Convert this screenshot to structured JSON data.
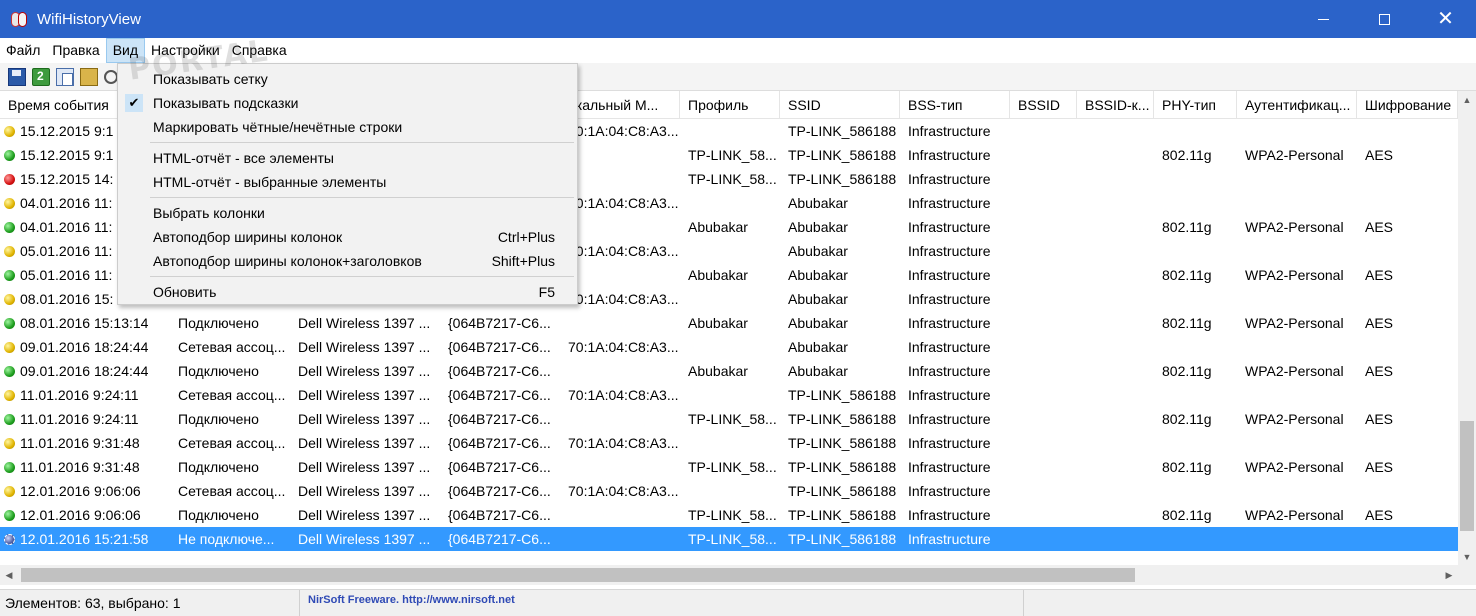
{
  "window": {
    "title": "WifiHistoryView",
    "controls": {
      "minimize": "minimize",
      "maximize": "maximize",
      "close": "✕"
    }
  },
  "menubar": [
    "Файл",
    "Правка",
    "Вид",
    "Настройки",
    "Справка"
  ],
  "toolbar": [
    "save-icon",
    "refresh-icon",
    "copy-icon",
    "properties-icon",
    "find-icon"
  ],
  "columns": [
    "Время события",
    "",
    "",
    "",
    "окальный М...",
    "Профиль",
    "SSID",
    "BSS-тип",
    "BSSID",
    "BSSID-к...",
    "PHY-тип",
    "Аутентификац...",
    "Шифрование"
  ],
  "rows": [
    {
      "status": "yellow",
      "time": "15.12.2015 9:1",
      "event": "",
      "adapter": "",
      "guid": "",
      "mac": "70:1A:04:C8:A3...",
      "profile": "",
      "ssid": "TP-LINK_586188",
      "bss": "Infrastructure",
      "bssid": "",
      "bssid2": "",
      "phy": "",
      "auth": "",
      "enc": ""
    },
    {
      "status": "green",
      "time": "15.12.2015 9:1",
      "event": "",
      "adapter": "",
      "guid": "",
      "mac": "",
      "profile": "TP-LINK_58...",
      "ssid": "TP-LINK_586188",
      "bss": "Infrastructure",
      "bssid": "",
      "bssid2": "",
      "phy": "802.11g",
      "auth": "WPA2-Personal",
      "enc": "AES"
    },
    {
      "status": "red",
      "time": "15.12.2015 14:",
      "event": "",
      "adapter": "",
      "guid": "",
      "mac": "",
      "profile": "TP-LINK_58...",
      "ssid": "TP-LINK_586188",
      "bss": "Infrastructure",
      "bssid": "",
      "bssid2": "",
      "phy": "",
      "auth": "",
      "enc": ""
    },
    {
      "status": "yellow",
      "time": "04.01.2016 11:",
      "event": "",
      "adapter": "",
      "guid": "",
      "mac": "70:1A:04:C8:A3...",
      "profile": "",
      "ssid": "Abubakar",
      "bss": "Infrastructure",
      "bssid": "",
      "bssid2": "",
      "phy": "",
      "auth": "",
      "enc": ""
    },
    {
      "status": "green",
      "time": "04.01.2016 11:",
      "event": "",
      "adapter": "",
      "guid": "",
      "mac": "",
      "profile": "Abubakar",
      "ssid": "Abubakar",
      "bss": "Infrastructure",
      "bssid": "",
      "bssid2": "",
      "phy": "802.11g",
      "auth": "WPA2-Personal",
      "enc": "AES"
    },
    {
      "status": "yellow",
      "time": "05.01.2016 11:",
      "event": "",
      "adapter": "",
      "guid": "",
      "mac": "70:1A:04:C8:A3...",
      "profile": "",
      "ssid": "Abubakar",
      "bss": "Infrastructure",
      "bssid": "",
      "bssid2": "",
      "phy": "",
      "auth": "",
      "enc": ""
    },
    {
      "status": "green",
      "time": "05.01.2016 11:",
      "event": "",
      "adapter": "",
      "guid": "",
      "mac": "",
      "profile": "Abubakar",
      "ssid": "Abubakar",
      "bss": "Infrastructure",
      "bssid": "",
      "bssid2": "",
      "phy": "802.11g",
      "auth": "WPA2-Personal",
      "enc": "AES"
    },
    {
      "status": "yellow",
      "time": "08.01.2016 15:",
      "event": "",
      "adapter": "",
      "guid": "",
      "mac": "70:1A:04:C8:A3...",
      "profile": "",
      "ssid": "Abubakar",
      "bss": "Infrastructure",
      "bssid": "",
      "bssid2": "",
      "phy": "",
      "auth": "",
      "enc": ""
    },
    {
      "status": "green",
      "time": "08.01.2016 15:13:14",
      "event": "Подключено",
      "adapter": "Dell Wireless 1397 ...",
      "guid": "{064B7217-C6...",
      "mac": "",
      "profile": "Abubakar",
      "ssid": "Abubakar",
      "bss": "Infrastructure",
      "bssid": "",
      "bssid2": "",
      "phy": "802.11g",
      "auth": "WPA2-Personal",
      "enc": "AES"
    },
    {
      "status": "yellow",
      "time": "09.01.2016 18:24:44",
      "event": "Сетевая ассоц...",
      "adapter": "Dell Wireless 1397 ...",
      "guid": "{064B7217-C6...",
      "mac": "70:1A:04:C8:A3...",
      "profile": "",
      "ssid": "Abubakar",
      "bss": "Infrastructure",
      "bssid": "",
      "bssid2": "",
      "phy": "",
      "auth": "",
      "enc": ""
    },
    {
      "status": "green",
      "time": "09.01.2016 18:24:44",
      "event": "Подключено",
      "adapter": "Dell Wireless 1397 ...",
      "guid": "{064B7217-C6...",
      "mac": "",
      "profile": "Abubakar",
      "ssid": "Abubakar",
      "bss": "Infrastructure",
      "bssid": "",
      "bssid2": "",
      "phy": "802.11g",
      "auth": "WPA2-Personal",
      "enc": "AES"
    },
    {
      "status": "yellow",
      "time": "11.01.2016 9:24:11",
      "event": "Сетевая ассоц...",
      "adapter": "Dell Wireless 1397 ...",
      "guid": "{064B7217-C6...",
      "mac": "70:1A:04:C8:A3...",
      "profile": "",
      "ssid": "TP-LINK_586188",
      "bss": "Infrastructure",
      "bssid": "",
      "bssid2": "",
      "phy": "",
      "auth": "",
      "enc": ""
    },
    {
      "status": "green",
      "time": "11.01.2016 9:24:11",
      "event": "Подключено",
      "adapter": "Dell Wireless 1397 ...",
      "guid": "{064B7217-C6...",
      "mac": "",
      "profile": "TP-LINK_58...",
      "ssid": "TP-LINK_586188",
      "bss": "Infrastructure",
      "bssid": "",
      "bssid2": "",
      "phy": "802.11g",
      "auth": "WPA2-Personal",
      "enc": "AES"
    },
    {
      "status": "yellow",
      "time": "11.01.2016 9:31:48",
      "event": "Сетевая ассоц...",
      "adapter": "Dell Wireless 1397 ...",
      "guid": "{064B7217-C6...",
      "mac": "70:1A:04:C8:A3...",
      "profile": "",
      "ssid": "TP-LINK_586188",
      "bss": "Infrastructure",
      "bssid": "",
      "bssid2": "",
      "phy": "",
      "auth": "",
      "enc": ""
    },
    {
      "status": "green",
      "time": "11.01.2016 9:31:48",
      "event": "Подключено",
      "adapter": "Dell Wireless 1397 ...",
      "guid": "{064B7217-C6...",
      "mac": "",
      "profile": "TP-LINK_58...",
      "ssid": "TP-LINK_586188",
      "bss": "Infrastructure",
      "bssid": "",
      "bssid2": "",
      "phy": "802.11g",
      "auth": "WPA2-Personal",
      "enc": "AES"
    },
    {
      "status": "yellow",
      "time": "12.01.2016 9:06:06",
      "event": "Сетевая ассоц...",
      "adapter": "Dell Wireless 1397 ...",
      "guid": "{064B7217-C6...",
      "mac": "70:1A:04:C8:A3...",
      "profile": "",
      "ssid": "TP-LINK_586188",
      "bss": "Infrastructure",
      "bssid": "",
      "bssid2": "",
      "phy": "",
      "auth": "",
      "enc": ""
    },
    {
      "status": "green",
      "time": "12.01.2016 9:06:06",
      "event": "Подключено",
      "adapter": "Dell Wireless 1397 ...",
      "guid": "{064B7217-C6...",
      "mac": "",
      "profile": "TP-LINK_58...",
      "ssid": "TP-LINK_586188",
      "bss": "Infrastructure",
      "bssid": "",
      "bssid2": "",
      "phy": "802.11g",
      "auth": "WPA2-Personal",
      "enc": "AES"
    },
    {
      "status": "grey",
      "time": "12.01.2016 15:21:58",
      "event": "Не подключе...",
      "adapter": "Dell Wireless 1397 ...",
      "guid": "{064B7217-C6...",
      "mac": "",
      "profile": "TP-LINK_58...",
      "ssid": "TP-LINK_586188",
      "bss": "Infrastructure",
      "bssid": "",
      "bssid2": "",
      "phy": "",
      "auth": "",
      "enc": "",
      "selected": true
    }
  ],
  "dropdown": {
    "items": [
      {
        "label": "Показывать сетку",
        "shortcut": "",
        "checked": false
      },
      {
        "label": "Показывать подсказки",
        "shortcut": "",
        "checked": true
      },
      {
        "label": "Маркировать чётные/нечётные строки",
        "shortcut": "",
        "checked": false
      },
      {
        "label": "HTML-отчёт - все элементы",
        "shortcut": "",
        "checked": false
      },
      {
        "label": "HTML-отчёт - выбранные элементы",
        "shortcut": "",
        "checked": false
      },
      {
        "label": "Выбрать колонки",
        "shortcut": "",
        "checked": false
      },
      {
        "label": "Автоподбор ширины колонок",
        "shortcut": "Ctrl+Plus",
        "checked": false
      },
      {
        "label": "Автоподбор ширины колонок+заголовков",
        "shortcut": "Shift+Plus",
        "checked": false
      },
      {
        "label": "Обновить",
        "shortcut": "F5",
        "checked": false
      }
    ]
  },
  "status": {
    "count": "Элементов: 63, выбрано: 1",
    "link": "NirSoft Freeware.  http://www.nirsoft.net"
  },
  "watermark": "PORTAL",
  "colors": {
    "titlebar": "#2b63c9",
    "selection": "#3399ff",
    "menu_highlight": "#cce4f7",
    "status_link": "#2f4ab5"
  }
}
